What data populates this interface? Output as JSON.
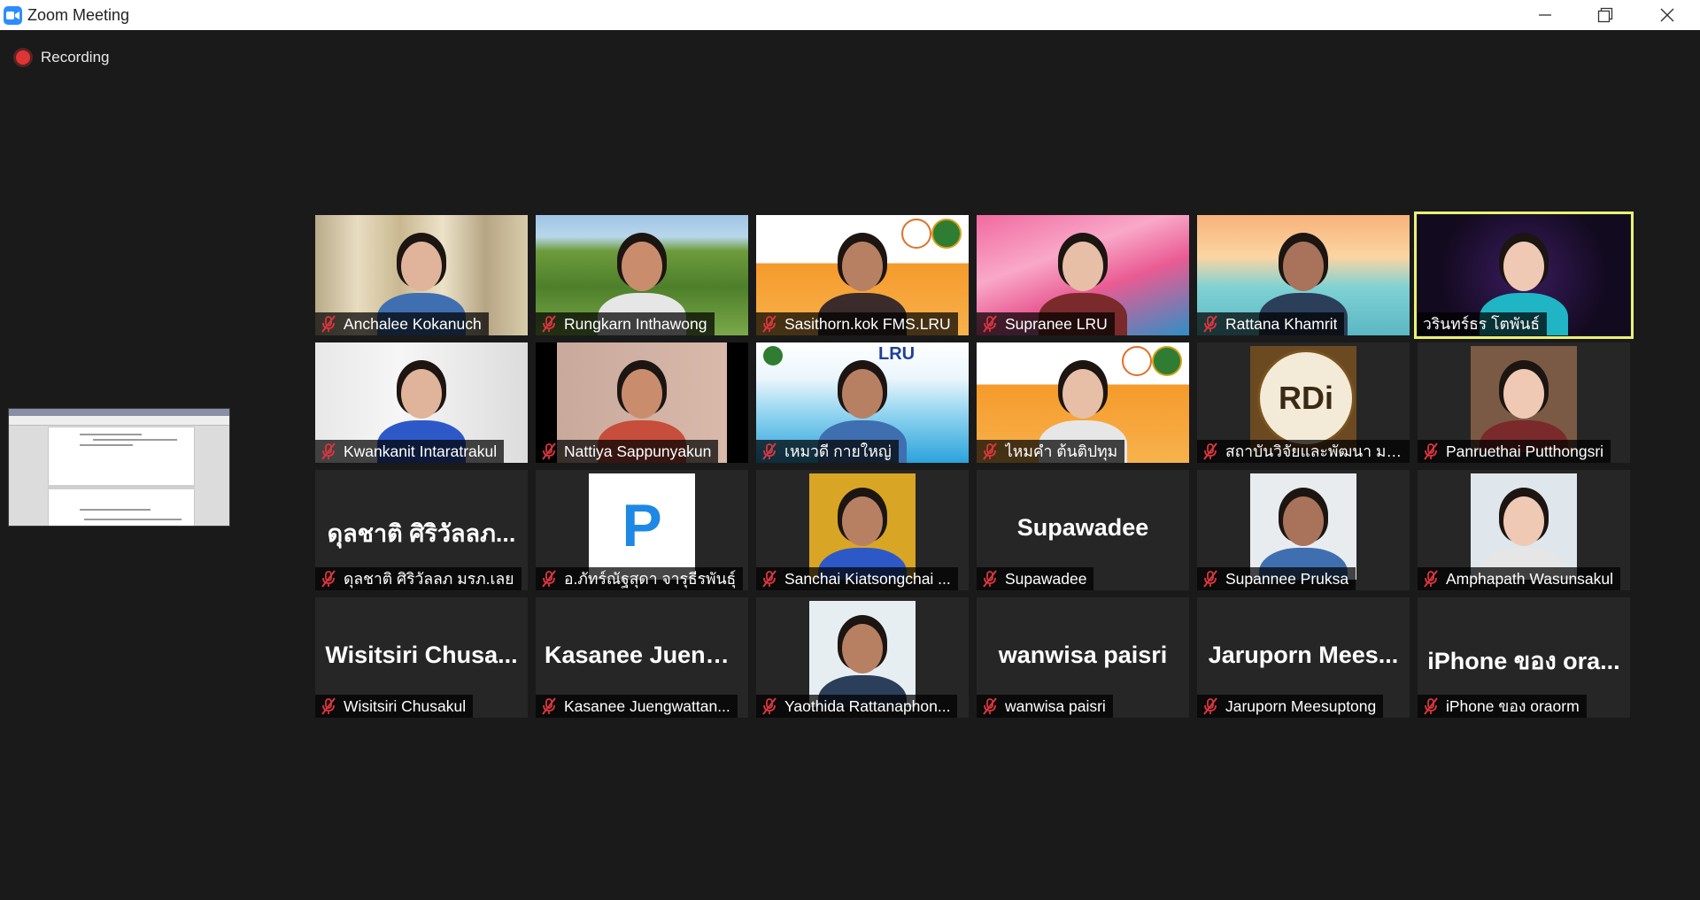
{
  "window": {
    "title": "Zoom Meeting",
    "icon": "zoom-camera-icon",
    "controls": [
      "minimize-icon",
      "restore-icon",
      "close-icon"
    ]
  },
  "recording": {
    "label": "Recording",
    "color": "#e03535"
  },
  "colors": {
    "background": "#1a1a1a",
    "tile": "#262626",
    "active_speaker": "#eaf07a",
    "mute": "#d9363e"
  },
  "participants": [
    {
      "name": "Anchalee Kokanuch",
      "muted": true,
      "video": "on"
    },
    {
      "name": "Rungkarn Inthawong",
      "muted": true,
      "video": "on"
    },
    {
      "name": "Sasithorn.kok FMS.LRU",
      "muted": true,
      "video": "on"
    },
    {
      "name": "Supranee LRU",
      "muted": true,
      "video": "on"
    },
    {
      "name": "Rattana Khamrit",
      "muted": true,
      "video": "on"
    },
    {
      "name": "วรินทร์ธร โตพันธ์",
      "muted": false,
      "video": "on",
      "active_speaker": true
    },
    {
      "name": "Kwankanit Intaratrakul",
      "muted": true,
      "video": "on"
    },
    {
      "name": "Nattiya Sappunyakun",
      "muted": true,
      "video": "on"
    },
    {
      "name": "เหมวดี กายใหญ่",
      "muted": true,
      "video": "on"
    },
    {
      "name": "ไหมคำ ต้นติปทุม",
      "muted": true,
      "video": "on"
    },
    {
      "name": "สถาบันวิจัยและพัฒนา มห...",
      "muted": true,
      "video": "picture"
    },
    {
      "name": "Panruethai Putthongsri",
      "muted": true,
      "video": "picture"
    },
    {
      "name": "ดุลชาติ ศิริวัลลภ มรภ.เลย",
      "display": "ดุลชาติ ศิริวัลลภ...",
      "muted": true,
      "video": "off"
    },
    {
      "name": "อ.ภัทร์ณัฐสุดา จารุธีรพันธุ์",
      "muted": true,
      "video": "picture"
    },
    {
      "name": "Sanchai Kiatsongchai ...",
      "muted": true,
      "video": "picture"
    },
    {
      "name": "Supawadee",
      "display": "Supawadee",
      "muted": true,
      "video": "off"
    },
    {
      "name": "Supannee Pruksa",
      "muted": true,
      "video": "picture"
    },
    {
      "name": "Amphapath Wasunsakul",
      "muted": true,
      "video": "picture"
    },
    {
      "name": "Wisitsiri  Chusakul",
      "display": "Wisitsiri  Chusa...",
      "muted": true,
      "video": "off"
    },
    {
      "name": "Kasanee Juengwattan...",
      "display": "Kasanee  Jueng...",
      "muted": true,
      "video": "off"
    },
    {
      "name": "Yaothida Rattanaphon...",
      "muted": true,
      "video": "picture"
    },
    {
      "name": "wanwisa paisri",
      "display": "wanwisa paisri",
      "muted": true,
      "video": "off"
    },
    {
      "name": "Jaruporn Meesuptong",
      "display": "Jaruporn  Mees...",
      "muted": true,
      "video": "off"
    },
    {
      "name": "iPhone ของ oraorm",
      "display": "iPhone ของ ora...",
      "muted": true,
      "video": "off"
    }
  ],
  "tile_graphics": {
    "rdi_logo_text": "RDi",
    "lru_logo_text": "LRU",
    "p_logo_text": "P"
  }
}
